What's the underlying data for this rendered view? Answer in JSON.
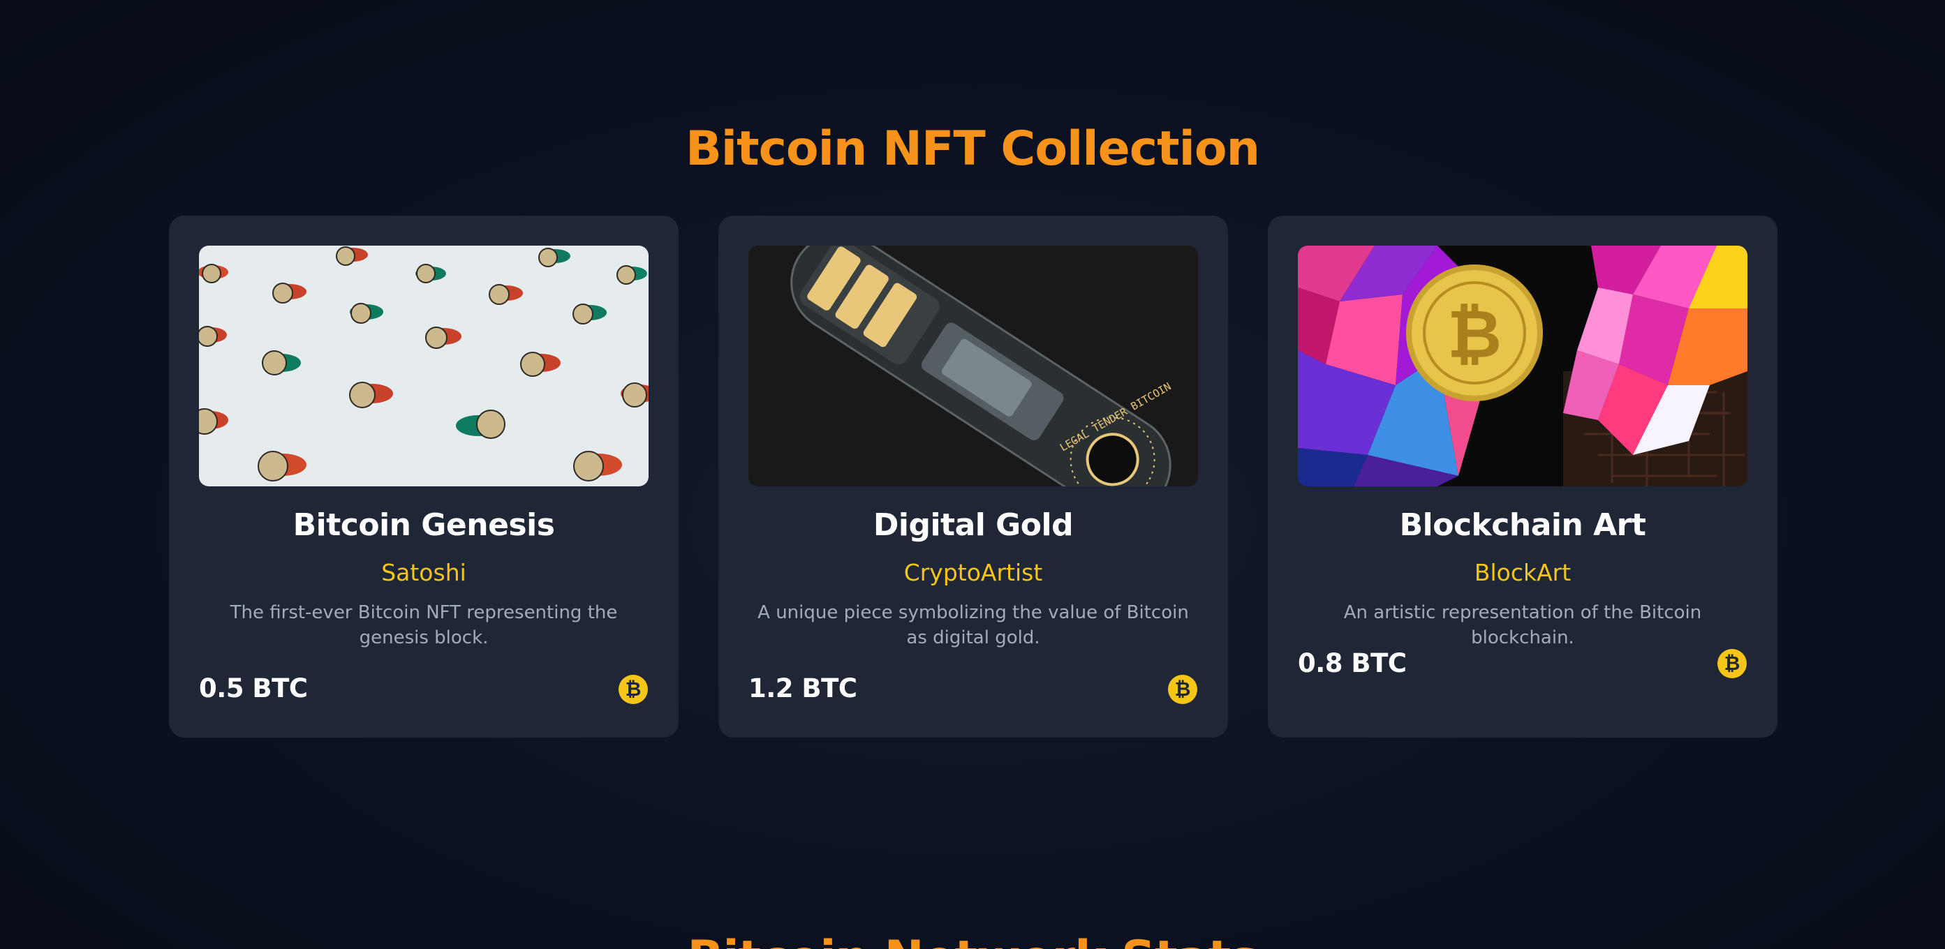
{
  "section": {
    "title": "Bitcoin NFT Collection",
    "next_title": "Bitcoin Network Stats"
  },
  "cards": [
    {
      "image_icon": "bitcoin-coins-pattern",
      "title": "Bitcoin Genesis",
      "artist": "Satoshi",
      "description": "The first-ever Bitcoin NFT representing the genesis block.",
      "price": "0.5 BTC",
      "currency_icon": "bitcoin-icon"
    },
    {
      "image_icon": "hardware-wallet",
      "title": "Digital Gold",
      "artist": "CryptoArtist",
      "description": "A unique piece symbolizing the value of Bitcoin as digital gold.",
      "price": "1.2 BTC",
      "currency_icon": "bitcoin-icon",
      "image_text": "LEGAL TENDER BITCOIN"
    },
    {
      "image_icon": "bitcoin-geometric-art",
      "title": "Blockchain Art",
      "artist": "BlockArt",
      "description": "An artistic representation of the Bitcoin blockchain.",
      "price": "0.8 BTC",
      "currency_icon": "bitcoin-icon"
    }
  ],
  "colors": {
    "accent": "#f7931a",
    "artist": "#f5c518",
    "card_bg": "#1f2737",
    "background": "#0b1120"
  },
  "btc_symbol": "₿"
}
